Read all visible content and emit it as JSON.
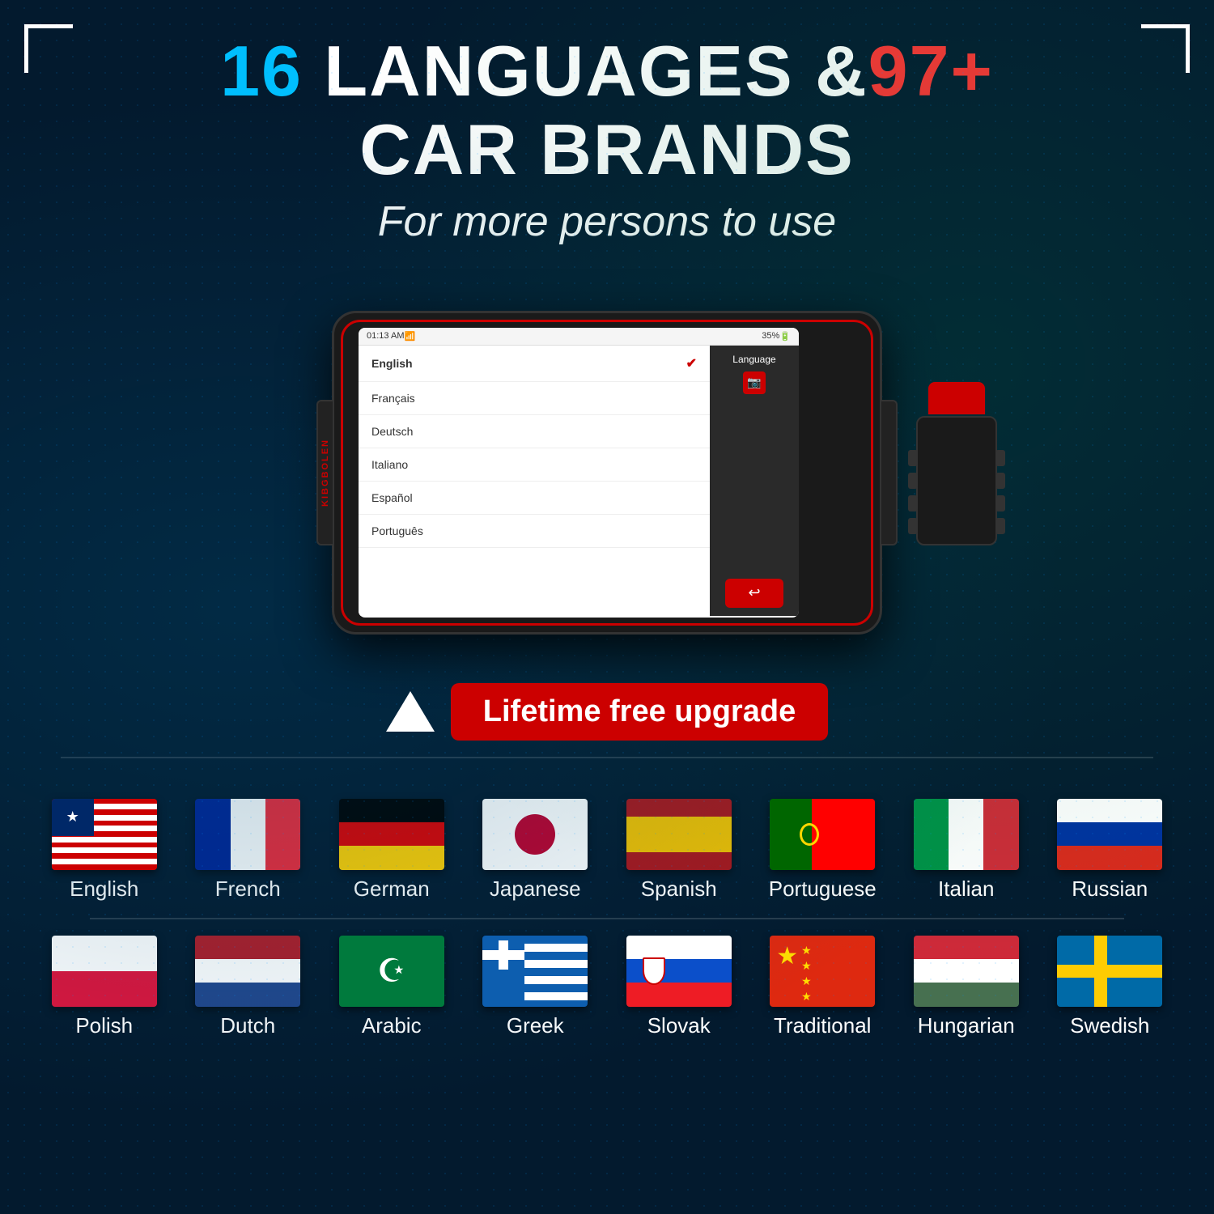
{
  "header": {
    "title_number": "16",
    "title_text": " LANGUAGES &",
    "title_accent": "97+",
    "title_line2": "CAR BRANDS",
    "subtitle": "For more persons to use"
  },
  "scanner": {
    "brand": "KIBGBOLEN",
    "statusbar": {
      "time": "01:13 AM",
      "battery": "35%"
    },
    "screen": {
      "selected_lang": "English",
      "languages": [
        "English",
        "Français",
        "Deutsch",
        "Italiano",
        "Español",
        "Português"
      ]
    },
    "panel": {
      "title": "Language",
      "back_icon": "↩"
    }
  },
  "upgrade": {
    "label": "Lifetime free upgrade"
  },
  "flags": {
    "row1": [
      {
        "label": "English",
        "code": "us"
      },
      {
        "label": "French",
        "code": "fr"
      },
      {
        "label": "German",
        "code": "de"
      },
      {
        "label": "Japanese",
        "code": "jp"
      },
      {
        "label": "Spanish",
        "code": "es"
      },
      {
        "label": "Portuguese",
        "code": "pt"
      },
      {
        "label": "Italian",
        "code": "it"
      },
      {
        "label": "Russian",
        "code": "ru"
      }
    ],
    "row2": [
      {
        "label": "Polish",
        "code": "pl"
      },
      {
        "label": "Dutch",
        "code": "nl"
      },
      {
        "label": "Arabic",
        "code": "ar"
      },
      {
        "label": "Greek",
        "code": "gr"
      },
      {
        "label": "Slovak",
        "code": "sk"
      },
      {
        "label": "Traditional",
        "code": "cn"
      },
      {
        "label": "Hungarian",
        "code": "hu"
      },
      {
        "label": "Swedish",
        "code": "se"
      }
    ]
  }
}
